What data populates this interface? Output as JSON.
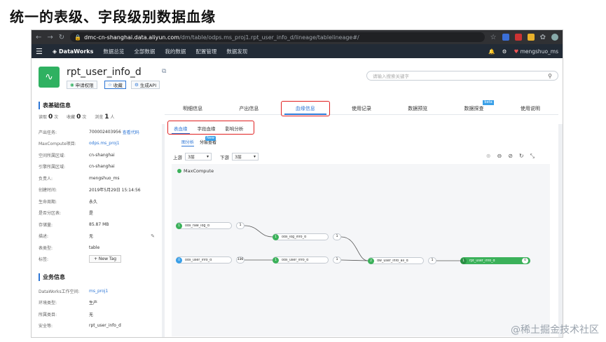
{
  "slide_title": "统一的表级、字段级别数据血缘",
  "browser": {
    "url_host": "dmc-cn-shanghai.data.aliyun.com",
    "url_path": "/dm/table/odps.ms_proj1.rpt_user_info_d/lineage/tablelineage#/"
  },
  "dw_nav": {
    "logo": "DataWorks",
    "items": [
      "数据总览",
      "全部数据",
      "我的数据",
      "配置管理",
      "数据发现"
    ],
    "user": "mengshuo_ms"
  },
  "table": {
    "name": "rpt_user_info_d",
    "btn_apply": "申请权限",
    "btn_fav": "收藏",
    "btn_api": "生成API"
  },
  "search": {
    "placeholder": "请输入搜索关键字"
  },
  "basic": {
    "title": "表基础信息",
    "read_label": "读取",
    "read_val": "0",
    "read_unit": "次",
    "fav_label": "收藏",
    "fav_val": "0",
    "fav_unit": "次",
    "view_label": "浏览",
    "view_val": "1",
    "view_unit": "人",
    "rows": [
      {
        "k": "产出任务:",
        "v": "700002403956",
        "link": "查看代码"
      },
      {
        "k": "MaxCompute项目:",
        "v": "",
        "link": "odps.ms_proj1"
      },
      {
        "k": "空间所属区域:",
        "v": "cn-shanghai",
        "link": ""
      },
      {
        "k": "引擎所属区域:",
        "v": "cn-shanghai",
        "link": ""
      },
      {
        "k": "负责人:",
        "v": "mengshuo_ms",
        "link": ""
      },
      {
        "k": "创建时间:",
        "v": "2019年5月29日 15:14:56",
        "link": ""
      },
      {
        "k": "生命周期:",
        "v": "永久",
        "link": ""
      },
      {
        "k": "是否分区表:",
        "v": "是",
        "link": ""
      },
      {
        "k": "存储量:",
        "v": "85.87 MB",
        "link": ""
      },
      {
        "k": "描述:",
        "v": "无",
        "link": ""
      },
      {
        "k": "表类型:",
        "v": "table",
        "link": ""
      }
    ],
    "tag_label": "标签:",
    "tag_btn": "+ New Tag"
  },
  "biz": {
    "title": "业务信息",
    "rows": [
      {
        "k": "DataWorks工作空间:",
        "v": "",
        "link": "ms_proj1"
      },
      {
        "k": "环境类型:",
        "v": "生产",
        "link": ""
      },
      {
        "k": "所属类目:",
        "v": "无",
        "link": ""
      },
      {
        "k": "安全等:",
        "v": "rpt_user_info_d",
        "link": ""
      }
    ]
  },
  "tabs": [
    "明细信息",
    "产出信息",
    "血缘信息",
    "使用记录",
    "数据预览",
    "数据探查",
    "使用说明"
  ],
  "beta_label": "beta",
  "subtabs": [
    "表血缘",
    "字段血缘",
    "影响分析"
  ],
  "view": {
    "graph": "图分析",
    "layer": "分层查看",
    "new_badge": "New"
  },
  "ctrl": {
    "up_label": "上游",
    "up_val": "3层",
    "down_label": "下游",
    "down_val": "3层"
  },
  "legend": "MaxCompute",
  "nodes": [
    {
      "id": "1",
      "label": "ods_raw_log_d",
      "color": "green"
    },
    {
      "id": "1",
      "label": "ods_log_info_d",
      "color": "green"
    },
    {
      "id": "0",
      "label": "ods_user_info_d",
      "color": "blue"
    },
    {
      "id": "1",
      "label": "ods_user_info_d",
      "color": "green"
    },
    {
      "id": "2",
      "label": "dw_user_info_all_d",
      "color": "green"
    },
    {
      "id": "1",
      "label": "rpt_user_info_d",
      "color": "green"
    }
  ],
  "counts": [
    "1",
    "1",
    "336",
    "1",
    "1",
    "0"
  ],
  "watermark": "@稀土掘金技术社区"
}
